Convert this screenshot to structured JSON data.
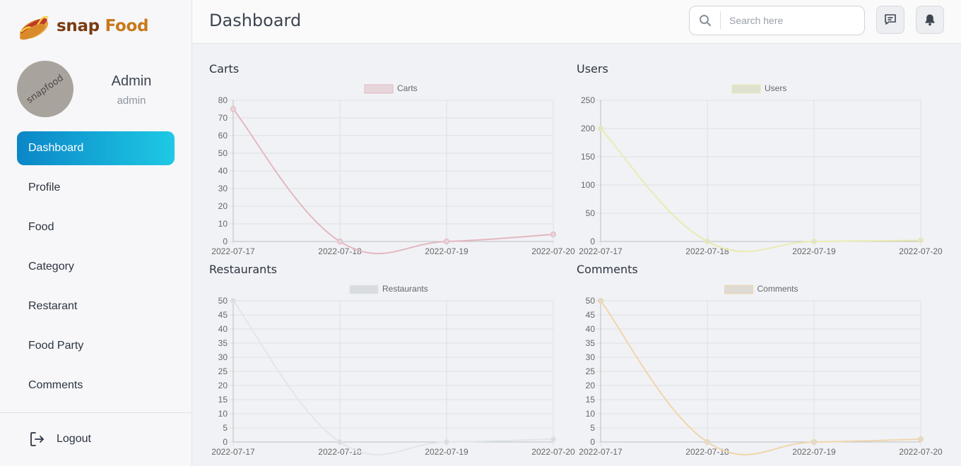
{
  "brand": {
    "part1": "snap",
    "part2": "Food"
  },
  "user": {
    "avatar_text": "snapfood",
    "name": "Admin",
    "role": "admin"
  },
  "nav": [
    {
      "label": "Dashboard",
      "active": true
    },
    {
      "label": "Profile"
    },
    {
      "label": "Food"
    },
    {
      "label": "Category"
    },
    {
      "label": "Restarant"
    },
    {
      "label": "Food Party"
    },
    {
      "label": "Comments"
    }
  ],
  "logout": {
    "label": "Logout"
  },
  "header": {
    "title": "Dashboard",
    "search_placeholder": "Search here"
  },
  "icons": {
    "search": "search-icon",
    "messages": "chat-message-icon",
    "notifications": "bell-icon",
    "logout": "logout-icon",
    "brand": "hotdog-icon"
  },
  "charts": [
    {
      "title": "Carts"
    },
    {
      "title": "Users"
    },
    {
      "title": "Restaurants"
    },
    {
      "title": "Comments"
    }
  ],
  "chart_data": [
    {
      "type": "line",
      "title": "Carts",
      "x": [
        "2022-07-17",
        "2022-07-18",
        "2022-07-19",
        "2022-07-20"
      ],
      "series": [
        {
          "name": "Carts",
          "values": [
            75,
            0,
            0,
            4
          ],
          "color": "#e3b8c0",
          "fill": "#e6d6db"
        }
      ],
      "ylim": [
        0,
        80
      ],
      "yticks": [
        0,
        10,
        20,
        30,
        40,
        50,
        60,
        70,
        80
      ],
      "legend": "top",
      "grid": true
    },
    {
      "type": "line",
      "title": "Users",
      "x": [
        "2022-07-17",
        "2022-07-18",
        "2022-07-19",
        "2022-07-20"
      ],
      "series": [
        {
          "name": "Users",
          "values": [
            200,
            0,
            0,
            2
          ],
          "color": "#e8ecb0",
          "fill": "#dfe2cf"
        }
      ],
      "ylim": [
        0,
        250
      ],
      "yticks": [
        0,
        50,
        100,
        150,
        200,
        250
      ],
      "legend": "top",
      "grid": true
    },
    {
      "type": "line",
      "title": "Restaurants",
      "x": [
        "2022-07-17",
        "2022-07-18",
        "2022-07-19",
        "2022-07-20"
      ],
      "series": [
        {
          "name": "Restaurants",
          "values": [
            50,
            0,
            0,
            1
          ],
          "color": "#dfe6ec",
          "fill": "#d8dce0"
        }
      ],
      "ylim": [
        0,
        50
      ],
      "yticks": [
        0,
        5,
        10,
        15,
        20,
        25,
        30,
        35,
        40,
        45,
        50
      ],
      "legend": "top",
      "grid": true
    },
    {
      "type": "line",
      "title": "Comments",
      "x": [
        "2022-07-17",
        "2022-07-18",
        "2022-07-19",
        "2022-07-20"
      ],
      "series": [
        {
          "name": "Comments",
          "values": [
            50,
            0,
            0,
            1
          ],
          "color": "#efd6ad",
          "fill": "#dedad4"
        }
      ],
      "ylim": [
        0,
        50
      ],
      "yticks": [
        0,
        5,
        10,
        15,
        20,
        25,
        30,
        35,
        40,
        45,
        50
      ],
      "legend": "top",
      "grid": true
    }
  ]
}
